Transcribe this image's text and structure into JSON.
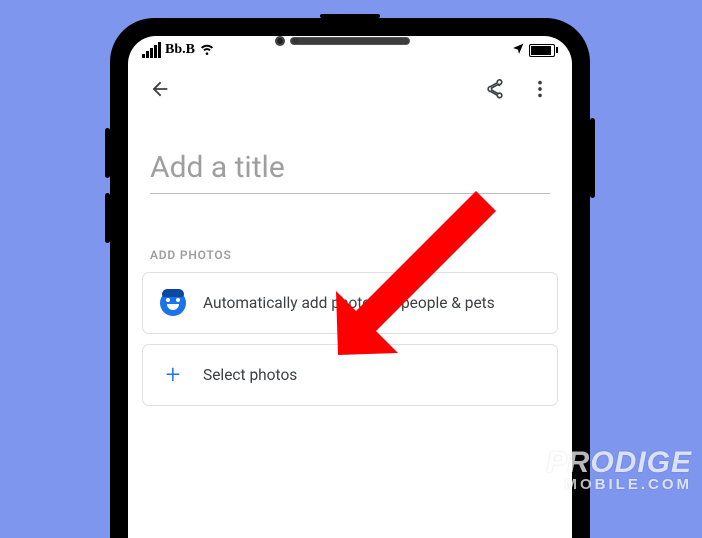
{
  "status": {
    "carrier": "Bb.B"
  },
  "title": {
    "placeholder": "Add a title",
    "value": ""
  },
  "section": {
    "label": "ADD PHOTOS"
  },
  "options": {
    "auto": {
      "label": "Automatically add photos of people & pets"
    },
    "select": {
      "label": "Select photos"
    }
  },
  "watermark": {
    "line1": "PRODIGE",
    "line2": "MOBILE.COM"
  }
}
